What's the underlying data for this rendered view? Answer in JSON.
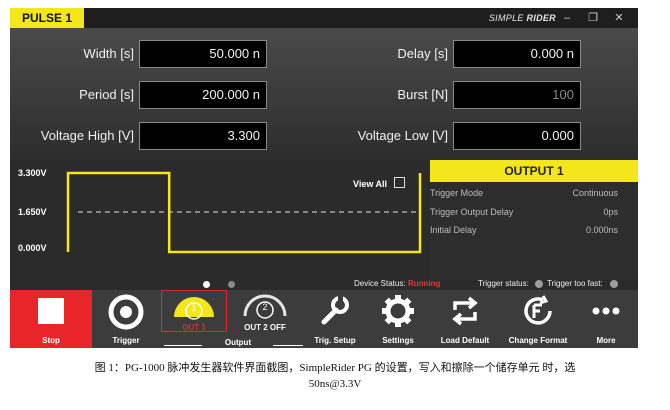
{
  "window": {
    "title": "PULSE 1",
    "brand_prefix": "SIMPLE",
    "brand_suffix": "RIDER",
    "minimize": "–",
    "restore": "❐",
    "close": "✕"
  },
  "params": {
    "width_label": "Width [s]",
    "width_value": "50.000 n",
    "delay_label": "Delay [s]",
    "delay_value": "0.000 n",
    "period_label": "Period [s]",
    "period_value": "200.000 n",
    "burst_label": "Burst [N]",
    "burst_value": "100",
    "vhigh_label": "Voltage High [V]",
    "vhigh_value": "3.300",
    "vlow_label": "Voltage Low [V]",
    "vlow_value": "0.000"
  },
  "waveform": {
    "v_top": "3.300V",
    "v_mid": "1.650V",
    "v_bot": "0.000V",
    "view_all_label": "View All",
    "view_all_checked": false,
    "trace_color": "#f3e61a",
    "duty": 0.25
  },
  "output": {
    "header": "OUTPUT 1",
    "rows": [
      {
        "key": "Trigger Mode",
        "value": "Continuous"
      },
      {
        "key": "Trigger Output Delay",
        "value": "0ps"
      },
      {
        "key": "Initial Delay",
        "value": "0.000ns"
      }
    ]
  },
  "status": {
    "device_label": "Device Status:",
    "device_value": "Running",
    "device_value_color": "#e03a3a",
    "trigger_status_label": "Trigger status:",
    "trigger_too_fast_label": "Trigger too fast:"
  },
  "toolbar": {
    "stop": "Stop",
    "trigger": "Trigger",
    "out1_num": "1",
    "out1": "OUT 1",
    "out2_num": "2",
    "out2": "OUT 2 OFF",
    "output_channels": "Output Channels",
    "trig_setup": "Trig. Setup",
    "settings": "Settings",
    "load_default": "Load Default",
    "change_format": "Change Format",
    "more": "More",
    "accent_red": "#e8262a",
    "accent_yellow": "#f3e61a"
  },
  "caption": {
    "line1": "图 1：PG-1000 脉冲发生器软件界面截图，SimpleRider PG 的设置，写入和擦除一个储存单元",
    "line1_tail": "时，选",
    "line2": "50ns@3.3V"
  }
}
